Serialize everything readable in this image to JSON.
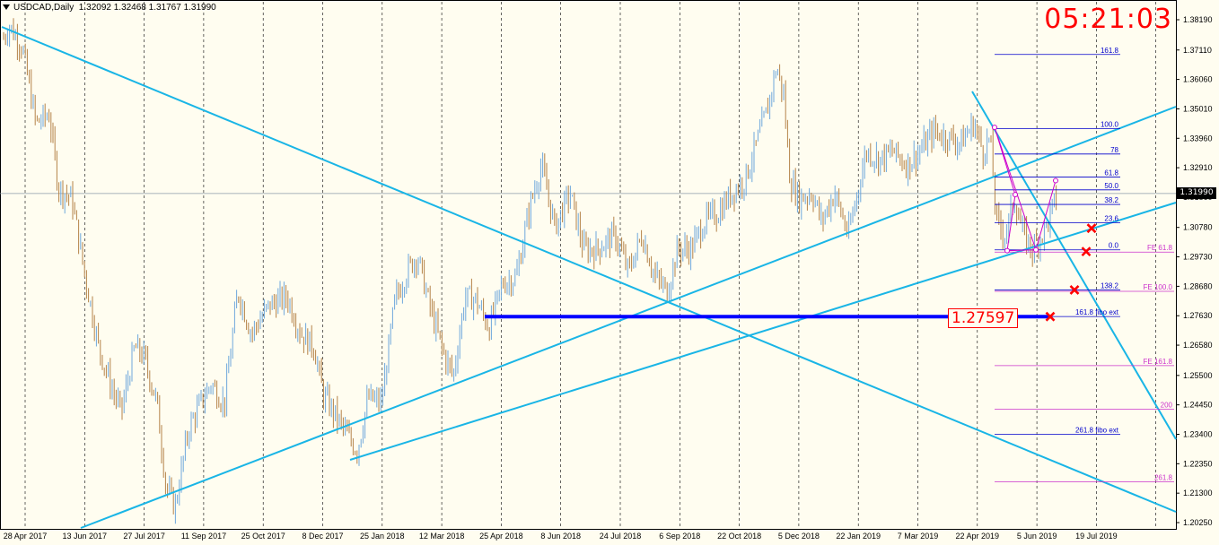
{
  "header": {
    "symbol": "USDCAD,Daily",
    "ohlc": "1.32092 1.32468 1.31767 1.31990"
  },
  "clock": "05:21:03",
  "current_price": "1.31990",
  "target_label": "1.27597",
  "colors": {
    "background": "#fffdf0",
    "up_candle": "#6fa8dc",
    "down_candle": "#b5844a",
    "trendline": "#19b5e6",
    "fib_blue": "#0000cc",
    "fe_magenta": "#cc33cc",
    "support_line": "#0000ff",
    "pattern": "#cc00cc",
    "marker": "#ff0000"
  },
  "chart_data": {
    "type": "candlestick",
    "title": "USDCAD,Daily",
    "ylim": [
      1.2026,
      1.3868
    ],
    "y_ticks": [
      "1.38190",
      "1.37110",
      "1.36060",
      "1.35010",
      "1.33960",
      "1.32910",
      "1.31860",
      "1.30780",
      "1.29730",
      "1.28680",
      "1.27630",
      "1.26580",
      "1.25500",
      "1.24450",
      "1.23400",
      "1.22350",
      "1.21300",
      "1.20250"
    ],
    "x_ticks": [
      "28 Apr 2017",
      "13 Jun 2017",
      "27 Jul 2017",
      "11 Sep 2017",
      "25 Oct 2017",
      "8 Dec 2017",
      "25 Jan 2018",
      "12 Mar 2018",
      "25 Apr 2018",
      "8 Jun 2018",
      "24 Jul 2018",
      "6 Sep 2018",
      "22 Oct 2018",
      "5 Dec 2018",
      "22 Jan 2019",
      "7 Mar 2019",
      "22 Apr 2019",
      "5 Jun 2019",
      "19 Jul 2019"
    ],
    "price_path": [
      [
        0,
        1.372
      ],
      [
        10,
        1.38
      ],
      [
        25,
        1.372
      ],
      [
        40,
        1.345
      ],
      [
        55,
        1.348
      ],
      [
        65,
        1.322
      ],
      [
        80,
        1.318
      ],
      [
        95,
        1.29
      ],
      [
        110,
        1.265
      ],
      [
        125,
        1.25
      ],
      [
        135,
        1.242
      ],
      [
        150,
        1.265
      ],
      [
        160,
        1.262
      ],
      [
        175,
        1.245
      ],
      [
        185,
        1.215
      ],
      [
        195,
        1.208
      ],
      [
        210,
        1.236
      ],
      [
        225,
        1.246
      ],
      [
        235,
        1.252
      ],
      [
        250,
        1.245
      ],
      [
        265,
        1.285
      ],
      [
        280,
        1.27
      ],
      [
        300,
        1.28
      ],
      [
        320,
        1.283
      ],
      [
        335,
        1.27
      ],
      [
        350,
        1.265
      ],
      [
        360,
        1.248
      ],
      [
        375,
        1.24
      ],
      [
        390,
        1.232
      ],
      [
        398,
        1.228
      ],
      [
        410,
        1.247
      ],
      [
        425,
        1.245
      ],
      [
        440,
        1.282
      ],
      [
        455,
        1.293
      ],
      [
        465,
        1.298
      ],
      [
        480,
        1.278
      ],
      [
        495,
        1.262
      ],
      [
        505,
        1.255
      ],
      [
        518,
        1.283
      ],
      [
        530,
        1.282
      ],
      [
        545,
        1.272
      ],
      [
        560,
        1.288
      ],
      [
        575,
        1.29
      ],
      [
        590,
        1.315
      ],
      [
        603,
        1.33
      ],
      [
        618,
        1.308
      ],
      [
        635,
        1.32
      ],
      [
        650,
        1.3
      ],
      [
        665,
        1.3
      ],
      [
        685,
        1.305
      ],
      [
        700,
        1.292
      ],
      [
        715,
        1.305
      ],
      [
        730,
        1.29
      ],
      [
        743,
        1.285
      ],
      [
        755,
        1.3
      ],
      [
        770,
        1.3
      ],
      [
        785,
        1.31
      ],
      [
        800,
        1.313
      ],
      [
        815,
        1.32
      ],
      [
        830,
        1.325
      ],
      [
        840,
        1.335
      ],
      [
        855,
        1.35
      ],
      [
        865,
        1.365
      ],
      [
        873,
        1.355
      ],
      [
        880,
        1.325
      ],
      [
        890,
        1.318
      ],
      [
        905,
        1.32
      ],
      [
        915,
        1.31
      ],
      [
        930,
        1.32
      ],
      [
        945,
        1.305
      ],
      [
        955,
        1.32
      ],
      [
        965,
        1.335
      ],
      [
        980,
        1.332
      ],
      [
        995,
        1.335
      ],
      [
        1010,
        1.33
      ],
      [
        1025,
        1.335
      ],
      [
        1040,
        1.342
      ],
      [
        1055,
        1.34
      ],
      [
        1070,
        1.338
      ],
      [
        1085,
        1.345
      ],
      [
        1095,
        1.335
      ],
      [
        1103,
        1.34
      ],
      [
        1110,
        1.31
      ],
      [
        1120,
        1.305
      ],
      [
        1130,
        1.318
      ],
      [
        1140,
        1.305
      ],
      [
        1150,
        1.3
      ],
      [
        1160,
        1.305
      ],
      [
        1168,
        1.31
      ],
      [
        1178,
        1.32
      ]
    ],
    "lines": [
      {
        "label": "161.8",
        "value": 1.3695,
        "group": "fib"
      },
      {
        "label": "100.0",
        "value": 1.343,
        "group": "fib"
      },
      {
        "label": "78",
        "value": 1.334,
        "group": "fib"
      },
      {
        "label": "61.8",
        "value": 1.3258,
        "group": "fib"
      },
      {
        "label": "50.0",
        "value": 1.3212,
        "group": "fib"
      },
      {
        "label": "38.2",
        "value": 1.316,
        "group": "fib"
      },
      {
        "label": "23.6",
        "value": 1.3095,
        "group": "fib"
      },
      {
        "label": "0.0",
        "value": 1.2998,
        "group": "fib"
      },
      {
        "label": "138.2",
        "value": 1.2855,
        "group": "fib"
      },
      {
        "label": "161.8 fibo ext",
        "value": 1.276,
        "group": "fib"
      },
      {
        "label": "261.8 fibo ext",
        "value": 1.234,
        "group": "fib"
      },
      {
        "label": "FE 61.8",
        "value": 1.299,
        "group": "fe"
      },
      {
        "label": "FE 100.0",
        "value": 1.285,
        "group": "fe"
      },
      {
        "label": "FE 161.8",
        "value": 1.2585,
        "group": "fe"
      },
      {
        "label": "200",
        "value": 1.243,
        "group": "fe"
      },
      {
        "label": "261.8",
        "value": 1.217,
        "group": "fe"
      }
    ],
    "support_level": 1.27597,
    "markers": [
      1.3075,
      1.2992,
      1.2855,
      1.276
    ]
  }
}
